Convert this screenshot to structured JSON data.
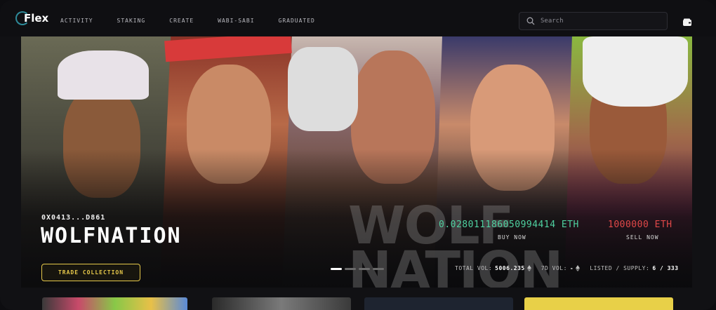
{
  "app": {
    "logo_text": "Flex"
  },
  "nav": {
    "items": [
      {
        "label": "ACTIVITY"
      },
      {
        "label": "STAKING"
      },
      {
        "label": "CREATE"
      },
      {
        "label": "WABI-SABI"
      },
      {
        "label": "GRADUATED"
      }
    ]
  },
  "search": {
    "placeholder": "Search",
    "value": ""
  },
  "icons": {
    "search": "search-icon",
    "wallet": "wallet-icon",
    "eth": "eth-icon"
  },
  "hero": {
    "address": "0X0413...D861",
    "collection_name": "WOLFNATION",
    "watermark": "WOLF\nNATION",
    "trade_button": "TRADE COLLECTION",
    "buy_price": "0.028011186050994414 ETH",
    "buy_label": "BUY NOW",
    "sell_price": "1000000 ETH",
    "sell_label": "SELL NOW",
    "carousel": {
      "total": 4,
      "active": 1
    },
    "stats": {
      "total_vol_label": "TOTAL VOL:",
      "total_vol_value": "5006.235",
      "vol_7d_label": "7D VOL:",
      "vol_7d_value": "-",
      "listed_label": "LISTED / SUPPLY:",
      "listed_value": "6 / 333"
    }
  },
  "colors": {
    "accent_yellow": "#e6c84a",
    "buy_green": "#4fd1a0",
    "sell_red": "#e04848",
    "background": "#0d0d10"
  }
}
